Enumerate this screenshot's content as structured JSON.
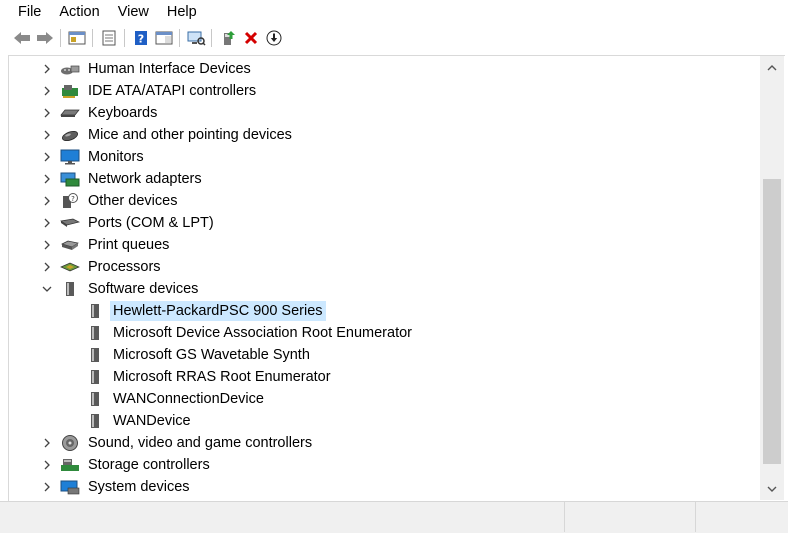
{
  "menu": [
    "File",
    "Action",
    "View",
    "Help"
  ],
  "toolbar": {
    "buttons": [
      "back-icon",
      "forward-icon",
      "show-hide-console-tree-icon",
      "properties-icon",
      "help-icon",
      "action-pane-icon",
      "scan-hardware-changes-icon",
      "update-driver-icon",
      "uninstall-device-icon",
      "disable-device-icon"
    ],
    "uninstall_color": "#d40000",
    "help_color": "#1f5fc5"
  },
  "tree": {
    "categories_before": [
      {
        "label": "Human Interface Devices",
        "icon": "hid-icon"
      },
      {
        "label": "IDE ATA/ATAPI controllers",
        "icon": "ide-controller-icon"
      },
      {
        "label": "Keyboards",
        "icon": "keyboard-icon"
      },
      {
        "label": "Mice and other pointing devices",
        "icon": "mouse-icon"
      },
      {
        "label": "Monitors",
        "icon": "monitor-icon"
      },
      {
        "label": "Network adapters",
        "icon": "network-adapter-icon"
      },
      {
        "label": "Other devices",
        "icon": "other-devices-icon"
      },
      {
        "label": "Ports (COM & LPT)",
        "icon": "port-icon"
      },
      {
        "label": "Print queues",
        "icon": "printer-icon"
      },
      {
        "label": "Processors",
        "icon": "processor-icon"
      }
    ],
    "expanded_category": {
      "label": "Software devices",
      "icon": "software-device-icon"
    },
    "children": [
      {
        "label": "Hewlett-PackardPSC 900 Series",
        "selected": true
      },
      {
        "label": "Microsoft Device Association Root Enumerator",
        "selected": false
      },
      {
        "label": "Microsoft GS Wavetable Synth",
        "selected": false
      },
      {
        "label": "Microsoft RRAS Root Enumerator",
        "selected": false
      },
      {
        "label": "WANConnectionDevice",
        "selected": false
      },
      {
        "label": "WANDevice",
        "selected": false
      }
    ],
    "categories_after": [
      {
        "label": "Sound, video and game controllers",
        "icon": "speaker-icon"
      },
      {
        "label": "Storage controllers",
        "icon": "storage-controller-icon"
      },
      {
        "label": "System devices",
        "icon": "system-device-icon"
      }
    ],
    "selection_color": "#cce8ff"
  },
  "scrollbar": {
    "position_fraction": 0.42,
    "visible_fraction": 0.66
  }
}
